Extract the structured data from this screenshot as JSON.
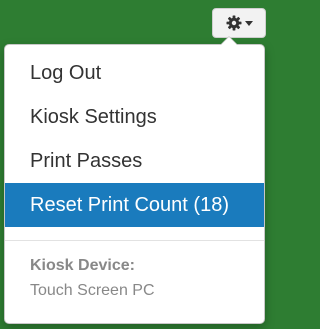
{
  "toolbar": {
    "settings_icon": "gear-icon",
    "dropdown_icon": "caret-down-icon"
  },
  "menu": {
    "items": [
      {
        "label": "Log Out"
      },
      {
        "label": "Kiosk Settings"
      },
      {
        "label": "Print Passes"
      },
      {
        "label": "Reset Print Count (18)",
        "active": true
      }
    ],
    "device_label": "Kiosk Device:",
    "device_value": "Touch Screen PC"
  },
  "colors": {
    "background": "#2e7d32",
    "active_item": "#1a7bbd",
    "text": "#333333",
    "muted_text": "#888888"
  }
}
